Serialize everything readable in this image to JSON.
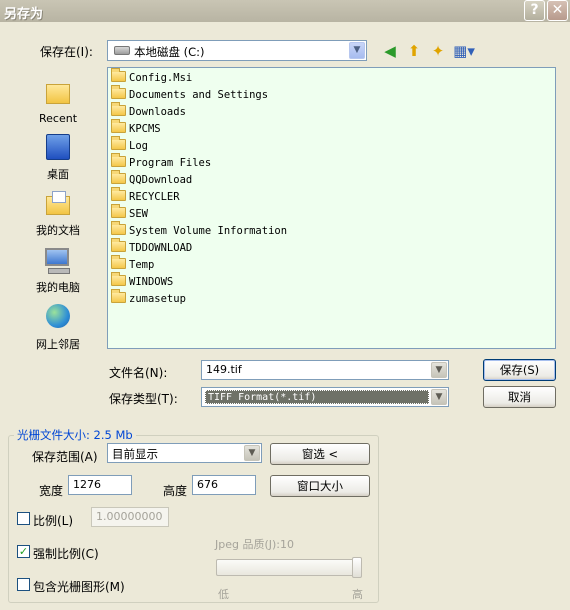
{
  "window": {
    "title": "另存为",
    "help_label": "?",
    "close_label": "✕"
  },
  "save_in": {
    "label": "保存在(I):",
    "value": "本地磁盘 (C:)"
  },
  "toolbar": {
    "back_icon": "back-icon",
    "up_icon": "up-folder-icon",
    "new_folder_icon": "new-folder-icon",
    "views_icon": "views-menu-icon"
  },
  "places": [
    {
      "label": "Recent",
      "icon": "recent-icon"
    },
    {
      "label": "桌面",
      "icon": "desktop-icon"
    },
    {
      "label": "我的文档",
      "icon": "my-documents-icon"
    },
    {
      "label": "我的电脑",
      "icon": "my-computer-icon"
    },
    {
      "label": "网上邻居",
      "icon": "network-places-icon"
    }
  ],
  "files": [
    "Config.Msi",
    "Documents and Settings",
    "Downloads",
    "KPCMS",
    "Log",
    "Program Files",
    "QQDownload",
    "RECYCLER",
    "SEW",
    "System Volume Information",
    "TDDOWNLOAD",
    "Temp",
    "WINDOWS",
    "zumasetup"
  ],
  "filename": {
    "label": "文件名(N):",
    "value": "149.tif"
  },
  "filetype": {
    "label": "保存类型(T):",
    "value": "TIFF Format(*.tif)"
  },
  "buttons": {
    "save": "保存(S)",
    "cancel": "取消"
  },
  "raster": {
    "title": "光栅文件大小: 2.5 Mb",
    "range_label": "保存范围(A)",
    "range_value": "目前显示",
    "window_select_button": "窗选 <",
    "width_label": "宽度",
    "width_value": "1276",
    "height_label": "高度",
    "height_value": "676",
    "window_size_button": "窗口大小",
    "scale_label": "比例(L)",
    "scale_checked": false,
    "scale_value": "1.00000000",
    "force_scale_label": "强制比例(C)",
    "force_scale_checked": true,
    "include_raster_label": "包含光栅图形(M)",
    "include_raster_checked": false,
    "jpeg_quality_label": "Jpeg 品质(J):10",
    "jpeg_quality_value": 10,
    "jpeg_quality_fraction": 1.0,
    "slider_low": "低",
    "slider_high": "高"
  }
}
